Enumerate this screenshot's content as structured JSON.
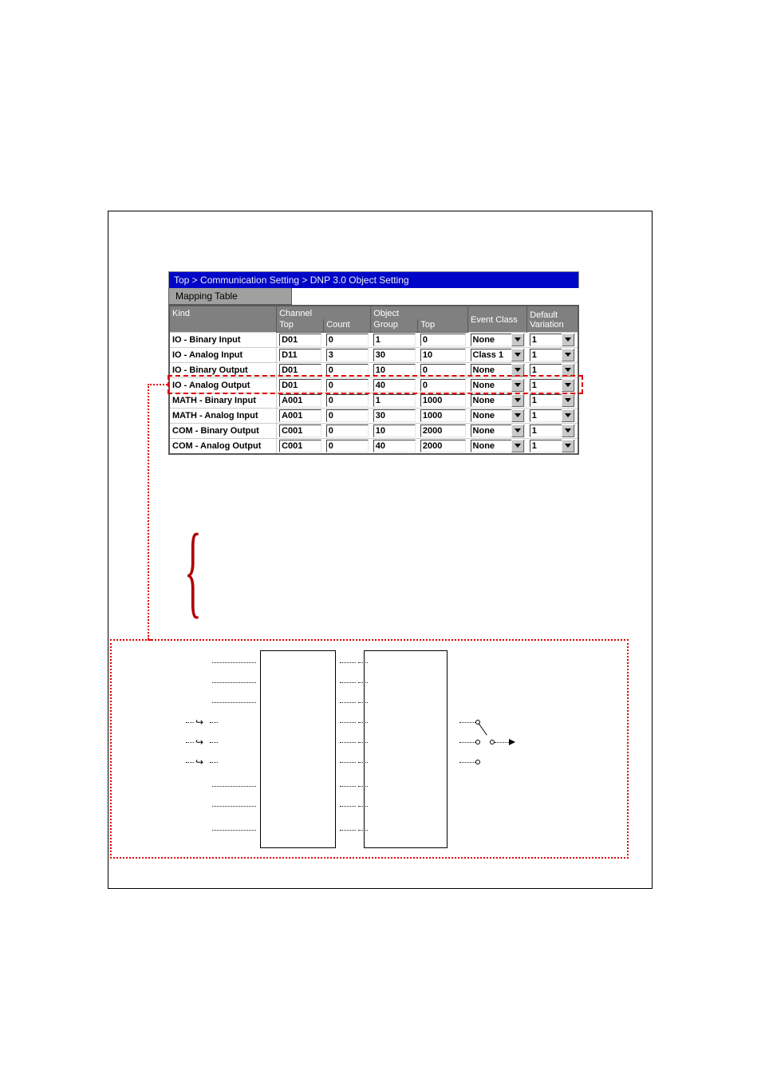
{
  "breadcrumb": "Top > Communication Setting > DNP 3.0 Object Setting",
  "tab_label": "Mapping Table",
  "headers": {
    "kind": "Kind",
    "channel": "Channel",
    "channel_top": "Top",
    "channel_count": "Count",
    "object": "Object",
    "object_group": "Group",
    "object_top": "Top",
    "event_class": "Event\nClass",
    "default_variation": "Default\nVariation"
  },
  "rows": [
    {
      "kind": "IO - Binary Input",
      "ch_top": "D01",
      "count": "0",
      "group": "1",
      "obj_top": "0",
      "ev": "None",
      "dv": "1"
    },
    {
      "kind": "IO - Analog Input",
      "ch_top": "D11",
      "count": "3",
      "group": "30",
      "obj_top": "10",
      "ev": "Class 1",
      "dv": "1"
    },
    {
      "kind": "IO - Binary Output",
      "ch_top": "D01",
      "count": "0",
      "group": "10",
      "obj_top": "0",
      "ev": "None",
      "dv": "1"
    },
    {
      "kind": "IO - Analog Output",
      "ch_top": "D01",
      "count": "0",
      "group": "40",
      "obj_top": "0",
      "ev": "None",
      "dv": "1"
    },
    {
      "kind": "MATH - Binary Input",
      "ch_top": "A001",
      "count": "0",
      "group": "1",
      "obj_top": "1000",
      "ev": "None",
      "dv": "1"
    },
    {
      "kind": "MATH - Analog Input",
      "ch_top": "A001",
      "count": "0",
      "group": "30",
      "obj_top": "1000",
      "ev": "None",
      "dv": "1"
    },
    {
      "kind": "COM - Binary Output",
      "ch_top": "C001",
      "count": "0",
      "group": "10",
      "obj_top": "2000",
      "ev": "None",
      "dv": "1"
    },
    {
      "kind": "COM - Analog Output",
      "ch_top": "C001",
      "count": "0",
      "group": "40",
      "obj_top": "2000",
      "ev": "None",
      "dv": "1"
    }
  ],
  "highlighted_row_index": 1
}
